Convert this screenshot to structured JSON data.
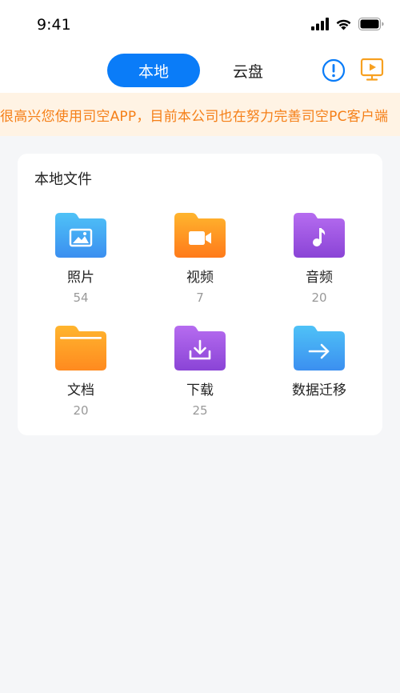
{
  "status": {
    "time": "9:41"
  },
  "header": {
    "tabs": [
      {
        "label": "本地",
        "active": true
      },
      {
        "label": "云盘",
        "active": false
      }
    ],
    "icons": [
      "info-icon",
      "tv-play-icon"
    ]
  },
  "notice": {
    "text": "很高兴您使用司空APP，目前本公司也在努力完善司空PC客户端"
  },
  "local_files": {
    "title": "本地文件",
    "items": [
      {
        "label": "照片",
        "count": "54",
        "icon": "photo-folder-icon",
        "color": "#3aa8f0"
      },
      {
        "label": "视频",
        "count": "7",
        "icon": "video-folder-icon",
        "color": "#ff8a1f"
      },
      {
        "label": "音频",
        "count": "20",
        "icon": "music-folder-icon",
        "color": "#9b52df"
      },
      {
        "label": "文档",
        "count": "20",
        "icon": "document-folder-icon",
        "color": "#ff9a1e"
      },
      {
        "label": "下载",
        "count": "25",
        "icon": "download-folder-icon",
        "color": "#a056dd"
      },
      {
        "label": "数据迁移",
        "count": "",
        "icon": "transfer-folder-icon",
        "color": "#38a3e8"
      }
    ]
  },
  "colors": {
    "accent": "#0a7cf8",
    "notice_text": "#f57f17",
    "notice_bg": "#fff3e4"
  }
}
